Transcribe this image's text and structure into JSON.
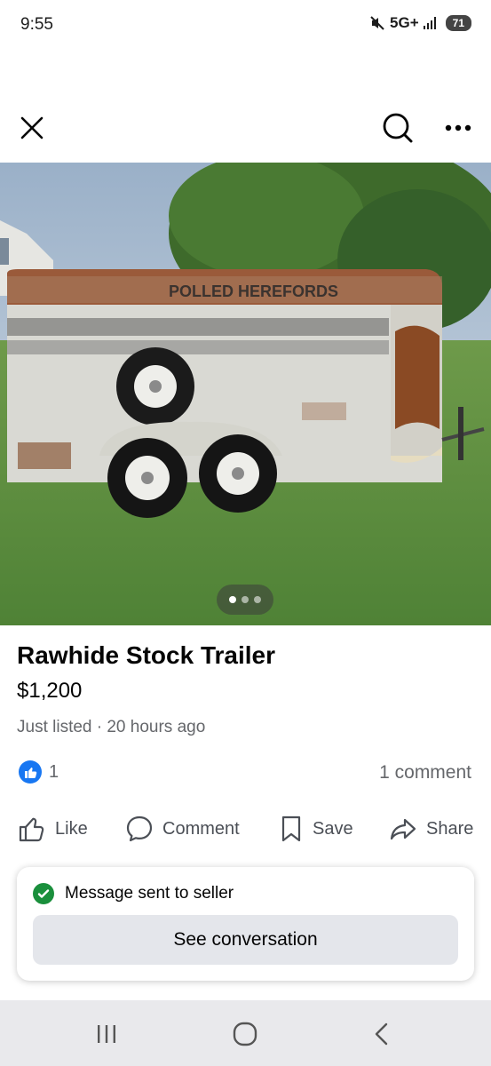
{
  "status_bar": {
    "time": "9:55",
    "network": "5G+",
    "battery": "71"
  },
  "top_bar": {
    "close_icon": "close-icon",
    "search_icon": "search-icon",
    "more_icon": "more-icon"
  },
  "photo": {
    "sign_text": "POLLED HEREFORDS",
    "page_count": 3,
    "active_page": 1
  },
  "listing": {
    "title": "Rawhide Stock Trailer",
    "price": "$1,200",
    "listed": "Just listed · 20 hours ago",
    "reaction_count": "1",
    "comment_count": "1 comment"
  },
  "actions": {
    "like": "Like",
    "comment": "Comment",
    "save": "Save",
    "share": "Share"
  },
  "message_card": {
    "status": "Message sent to seller",
    "button": "See conversation"
  },
  "colors": {
    "facebook_blue": "#1877f2",
    "success_green": "#1a8f3c",
    "secondary_text": "#65676b"
  }
}
